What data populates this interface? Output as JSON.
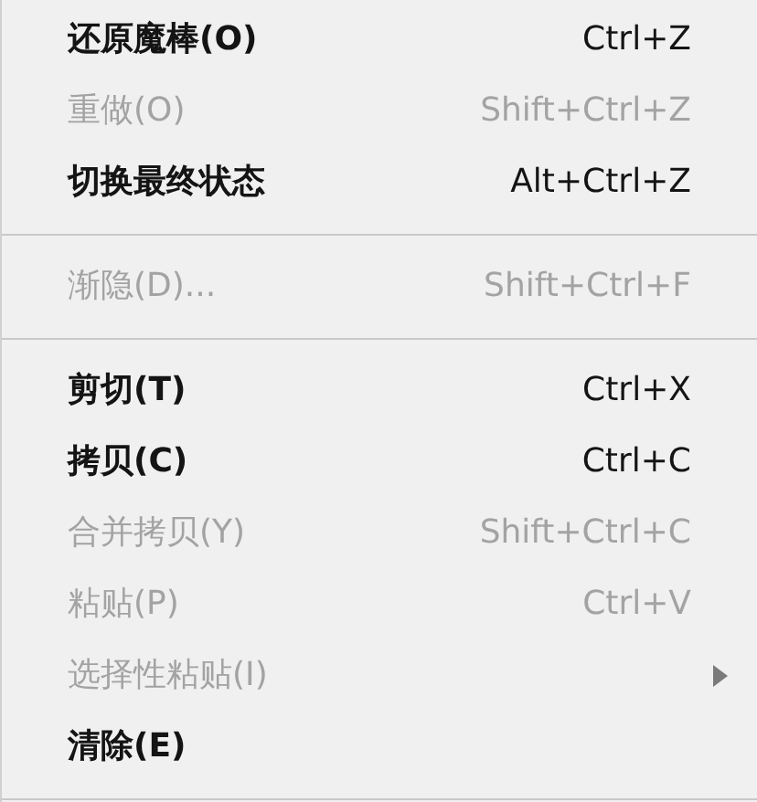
{
  "menu": {
    "items": [
      {
        "kind": "item",
        "label": "还原魔棒(O)",
        "shortcut": "Ctrl+Z",
        "disabled": false,
        "submenu": false
      },
      {
        "kind": "item",
        "label": "重做(O)",
        "shortcut": "Shift+Ctrl+Z",
        "disabled": true,
        "submenu": false
      },
      {
        "kind": "item",
        "label": "切换最终状态",
        "shortcut": "Alt+Ctrl+Z",
        "disabled": false,
        "submenu": false
      },
      {
        "kind": "separator"
      },
      {
        "kind": "item",
        "label": "渐隐(D)...",
        "shortcut": "Shift+Ctrl+F",
        "disabled": true,
        "submenu": false
      },
      {
        "kind": "separator"
      },
      {
        "kind": "item",
        "label": "剪切(T)",
        "shortcut": "Ctrl+X",
        "disabled": false,
        "submenu": false
      },
      {
        "kind": "item",
        "label": "拷贝(C)",
        "shortcut": "Ctrl+C",
        "disabled": false,
        "submenu": false
      },
      {
        "kind": "item",
        "label": "合并拷贝(Y)",
        "shortcut": "Shift+Ctrl+C",
        "disabled": true,
        "submenu": false
      },
      {
        "kind": "item",
        "label": "粘贴(P)",
        "shortcut": "Ctrl+V",
        "disabled": true,
        "submenu": false
      },
      {
        "kind": "item",
        "label": "选择性粘贴(I)",
        "disabled": true,
        "submenu": true
      },
      {
        "kind": "item",
        "label": "清除(E)",
        "disabled": false,
        "submenu": false
      },
      {
        "kind": "separator"
      }
    ]
  }
}
